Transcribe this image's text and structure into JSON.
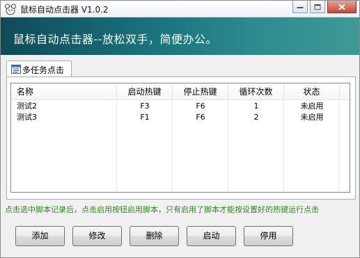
{
  "window": {
    "title": "鼠标自动点击器 V1.0.2",
    "banner": "鼠标自动点击器--放松双手，简便办公。"
  },
  "tabs": [
    {
      "label": "多任务点击",
      "icon": "list-icon"
    }
  ],
  "table": {
    "columns": [
      "名称",
      "启动热键",
      "停止热键",
      "循环次数",
      "状态"
    ],
    "rows": [
      {
        "name": "测试2",
        "start_hotkey": "F3",
        "stop_hotkey": "F6",
        "loop_count": "1",
        "status": "未启用"
      },
      {
        "name": "测试3",
        "start_hotkey": "F1",
        "stop_hotkey": "F6",
        "loop_count": "2",
        "status": "未启用"
      }
    ]
  },
  "hint": "点击选中脚本记录后，点击启用按钮启用脚本，只有启用了脚本才能按设置好的热键运行点击",
  "buttons": {
    "add": "添加",
    "edit": "修改",
    "delete": "删除",
    "start": "启动",
    "stop": "停用"
  },
  "colors": {
    "banner_start": "#0f4a58",
    "banner_end": "#3f9a97",
    "hint": "#2e8b1f"
  }
}
